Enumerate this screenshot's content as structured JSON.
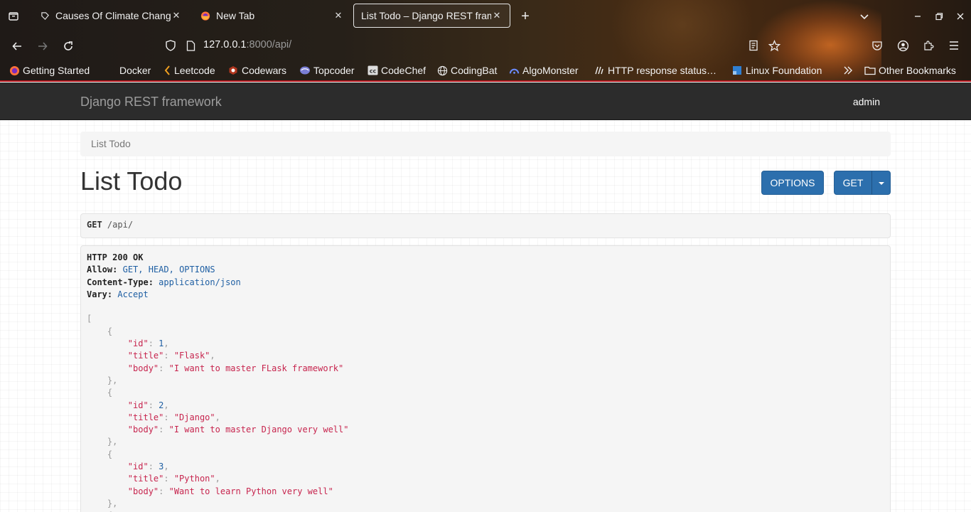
{
  "browser": {
    "tabs": [
      {
        "title": "Causes Of Climate Chang",
        "icon": "tag-icon",
        "active": false
      },
      {
        "title": "New Tab",
        "icon": "firefox-icon",
        "active": false
      },
      {
        "title": "List Todo – Django REST fram",
        "icon": "",
        "active": true
      }
    ],
    "url": {
      "host": "127.0.0.1",
      "rest": ":8000/api/"
    },
    "bookmarks": [
      {
        "label": "Getting Started",
        "icon": "firefox-icon"
      },
      {
        "label": "Docker",
        "icon": ""
      },
      {
        "label": "Leetcode",
        "icon": "leetcode-icon"
      },
      {
        "label": "Codewars",
        "icon": "codewars-icon"
      },
      {
        "label": "Topcoder",
        "icon": "topcoder-icon"
      },
      {
        "label": "CodeChef",
        "icon": "codechef-icon"
      },
      {
        "label": "CodingBat",
        "icon": "globe-icon"
      },
      {
        "label": "AlgoMonster",
        "icon": "algomonster-icon"
      },
      {
        "label": "HTTP response status…",
        "icon": "mdn-icon"
      },
      {
        "label": "Linux Foundation",
        "icon": "linux-foundation-icon"
      },
      {
        "label": "Other Bookmarks",
        "icon": "folder-icon"
      }
    ],
    "accent_color": "#b3131a"
  },
  "drf": {
    "brand": "Django REST framework",
    "user": "admin",
    "breadcrumb": "List Todo",
    "title": "List Todo",
    "buttons": {
      "options": "OPTIONS",
      "get": "GET"
    },
    "request": {
      "method": "GET",
      "path": "/api/"
    },
    "response": {
      "status": "HTTP 200 OK",
      "headers": [
        {
          "name": "Allow:",
          "value": "GET, HEAD, OPTIONS"
        },
        {
          "name": "Content-Type:",
          "value": "application/json"
        },
        {
          "name": "Vary:",
          "value": "Accept"
        }
      ],
      "todos": [
        {
          "id": "1",
          "title": "\"Flask\"",
          "body": "\"I want to master FLask framework\""
        },
        {
          "id": "2",
          "title": "\"Django\"",
          "body": "\"I want to master Django very well\""
        },
        {
          "id": "3",
          "title": "\"Python\"",
          "body": "\"Want to learn Python very well\""
        }
      ],
      "keys": {
        "id": "\"id\"",
        "title": "\"title\"",
        "body": "\"body\""
      }
    },
    "button_color": "#2c6fad"
  }
}
